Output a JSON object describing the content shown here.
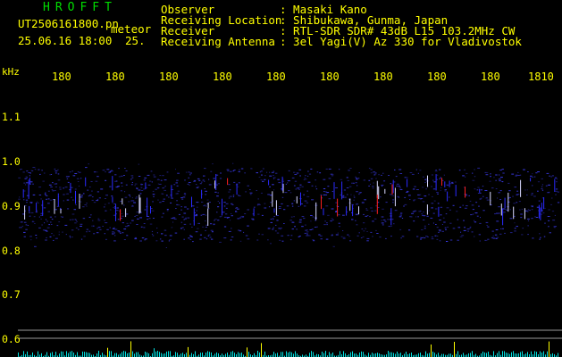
{
  "header": {
    "brand": "HROFFT",
    "file_name": "UT2506161800.pn",
    "meteor_label": "meteor",
    "datetime": "25.06.16 18:00",
    "count_partial": "25.",
    "info": [
      {
        "label": "Observer",
        "value": ": Masaki Kano"
      },
      {
        "label": "Receiving Location",
        "value": ": Shibukawa, Gunma, Japan"
      },
      {
        "label": "Receiver",
        "value": ": RTL-SDR SDR# 43dB L15 103.2MHz CW"
      },
      {
        "label": "Receiving Antenna",
        "value": ": 3el Yagi(V) Az 330 for Vladivostok"
      }
    ]
  },
  "axis": {
    "y_unit": "kHz",
    "y_ticks": [
      "1.1",
      "1.0",
      "0.9",
      "0.8",
      "0.7",
      "0.6"
    ],
    "x_ticks": [
      "180",
      "180",
      "180",
      "180",
      "180",
      "180",
      "180",
      "180",
      "180",
      "1810"
    ]
  },
  "colors": {
    "text_yellow": "#ffff00",
    "brand_green": "#00dd00",
    "waterfall_blue": "#2a2aff",
    "meteor_red": "#ff2020",
    "baseline_cyan": "#00e0e0",
    "divider_gray": "#9a9a9a"
  }
}
